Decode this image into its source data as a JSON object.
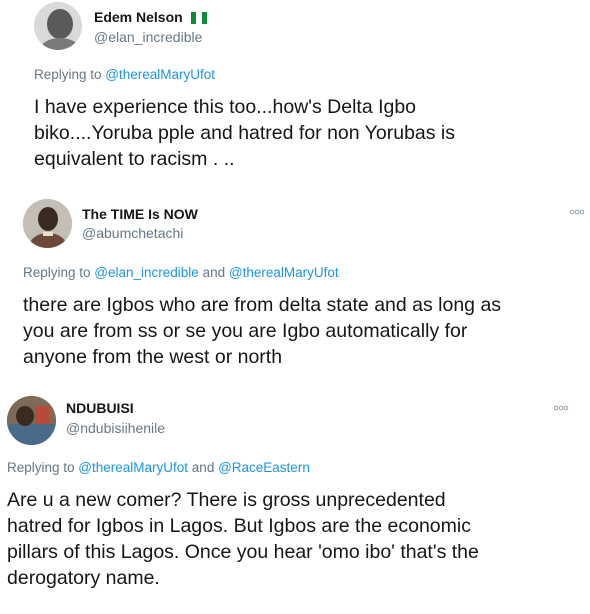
{
  "tweets": [
    {
      "name": "Edem Nelson",
      "has_flag": true,
      "handle": "@elan_incredible",
      "replying_prefix": "Replying to ",
      "mention1": "@therealMaryUfot",
      "joiner": "",
      "mention2": "",
      "lines": [
        "I have experience this too...how's Delta Igbo",
        "biko....Yoruba pple and hatred for non Yorubas is",
        "equivalent to racism  . .."
      ]
    },
    {
      "name": "The TIME Is NOW",
      "handle": "@abumchetachi",
      "replying_prefix": "Replying to ",
      "mention1": "@elan_incredible",
      "joiner": " and ",
      "mention2": "@therealMaryUfot",
      "lines": [
        "there are Igbos who are from delta state and as long as",
        "you are from ss or se you are Igbo automatically for",
        "anyone from the west or north"
      ]
    },
    {
      "name": "NDUBUISI",
      "handle": "@ndubisiihenile",
      "replying_prefix": "Replying to ",
      "mention1": "@therealMaryUfot",
      "joiner": " and ",
      "mention2": "@RaceEastern",
      "lines": [
        "Are u a new comer? There is gross unprecedented",
        "hatred for Igbos in Lagos. But Igbos are the economic",
        "pillars of this Lagos. Once you hear 'omo ibo' that's the",
        "derogatory name."
      ]
    }
  ],
  "colors": {
    "link": "#1b95e0",
    "muted": "#657786",
    "text": "#14171a",
    "flag_green": "#0d8a3a"
  }
}
